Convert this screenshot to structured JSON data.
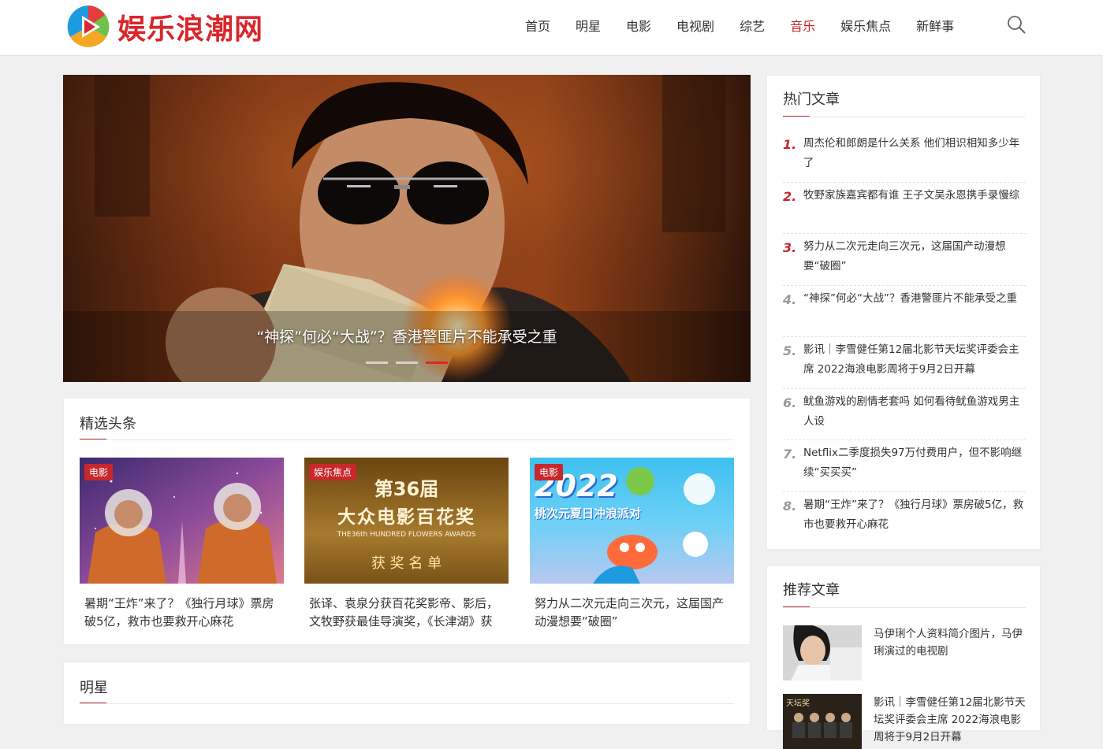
{
  "site": {
    "logo_text": "娱乐浪潮网",
    "accent_color": "#c8272c"
  },
  "nav": {
    "items": [
      {
        "label": "首页"
      },
      {
        "label": "明星"
      },
      {
        "label": "电影"
      },
      {
        "label": "电视剧"
      },
      {
        "label": "综艺"
      },
      {
        "label": "音乐",
        "active": true
      },
      {
        "label": "娱乐焦点"
      },
      {
        "label": "新鲜事"
      }
    ],
    "search_icon": "search-icon"
  },
  "slider": {
    "caption": "“神探”何必“大战”？香港警匪片不能承受之重",
    "dots": 3,
    "active_dot": 3
  },
  "featured": {
    "title": "精选头条",
    "cards": [
      {
        "tag": "电影",
        "title": "暑期“王炸”来了？《独行月球》票房破5亿，救市也要救开心麻花"
      },
      {
        "tag": "娱乐焦点",
        "title": "张译、袁泉分获百花奖影帝、影后，文牧野获最佳导演奖，《长津湖》获最佳故事片",
        "poster_line1": "第36届",
        "poster_line2": "大众电影百花奖",
        "poster_line3": "THE36th HUNDRED FLOWERS AWARDS",
        "poster_line4": "获 奖 名 单"
      },
      {
        "tag": "电影",
        "title": "努力从二次元走向三次元，这届国产动漫想要“破圈”",
        "poster_line1": "2022",
        "poster_line2": "桃次元夏日冲浪派对"
      }
    ]
  },
  "stars": {
    "title": "明星"
  },
  "hot": {
    "title": "热门文章",
    "items": [
      {
        "num": "1.",
        "text": "周杰伦和郎朗是什么关系 他们相识相知多少年了"
      },
      {
        "num": "2.",
        "text": "牧野家族嘉宾都有谁 王子文吴永恩携手录慢综"
      },
      {
        "num": "3.",
        "text": "努力从二次元走向三次元，这届国产动漫想要“破圈”"
      },
      {
        "num": "4.",
        "text": "“神探”何必“大战”？香港警匪片不能承受之重"
      },
      {
        "num": "5.",
        "text": "影讯｜李雪健任第12届北影节天坛奖评委会主席 2022海浪电影周将于9月2日开幕"
      },
      {
        "num": "6.",
        "text": "鱿鱼游戏的剧情老套吗 如何看待鱿鱼游戏男主人设"
      },
      {
        "num": "7.",
        "text": "Netflix二季度损失97万付费用户，但不影响继续“买买买”"
      },
      {
        "num": "8.",
        "text": "暑期“王炸”来了？《独行月球》票房破5亿，救市也要救开心麻花"
      }
    ]
  },
  "recommended": {
    "title": "推荐文章",
    "items": [
      {
        "text": "马伊琍个人资料简介图片，马伊琍演过的电视剧"
      },
      {
        "text": "影讯｜李雪健任第12届北影节天坛奖评委会主席 2022海浪电影周将于9月2日开幕",
        "poster_text": "天坛奖"
      }
    ]
  }
}
